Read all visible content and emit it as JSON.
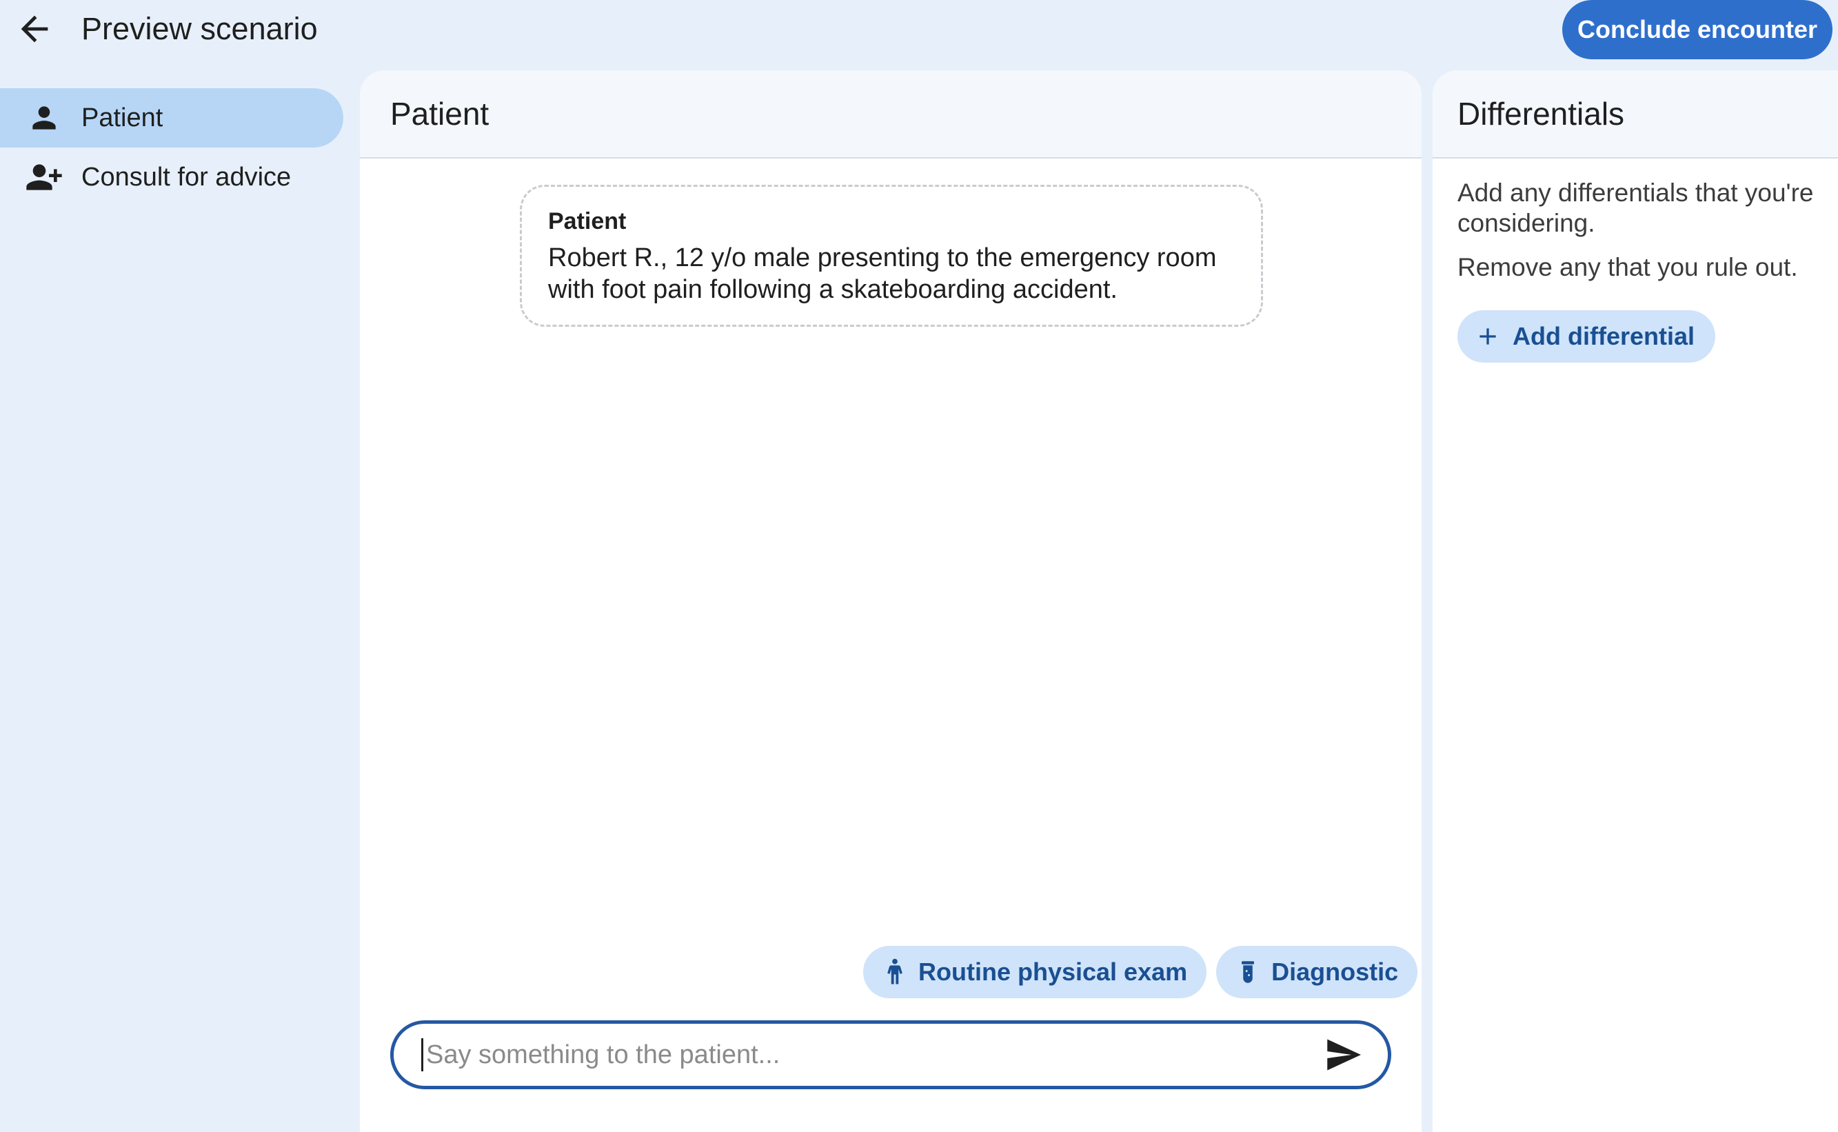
{
  "header": {
    "title": "Preview scenario",
    "back_icon": "arrow-left-icon",
    "conclude_label": "Conclude encounter",
    "accent_color": "#2f6fcc"
  },
  "sidebar": {
    "items": [
      {
        "label": "Patient",
        "icon": "person-icon",
        "active": true
      },
      {
        "label": "Consult for advice",
        "icon": "person-add-icon",
        "active": false
      }
    ]
  },
  "chat": {
    "title": "Patient",
    "messages": [
      {
        "sender": "Patient",
        "text": "Robert R., 12 y/o male presenting to the emergency room with foot pain following a skateboarding accident."
      }
    ],
    "actions": [
      {
        "label": "Routine physical exam",
        "icon": "standing-person-icon"
      },
      {
        "label": "Diagnostic",
        "icon": "test-tube-icon"
      }
    ],
    "input_placeholder": "Say something to the patient...",
    "input_value": "",
    "send_icon": "send-icon"
  },
  "differentials": {
    "title": "Differentials",
    "help_line1": "Add any differentials that you're considering.",
    "help_line2": "Remove any that you rule out.",
    "add_label": "Add differential",
    "add_icon": "plus-icon"
  }
}
